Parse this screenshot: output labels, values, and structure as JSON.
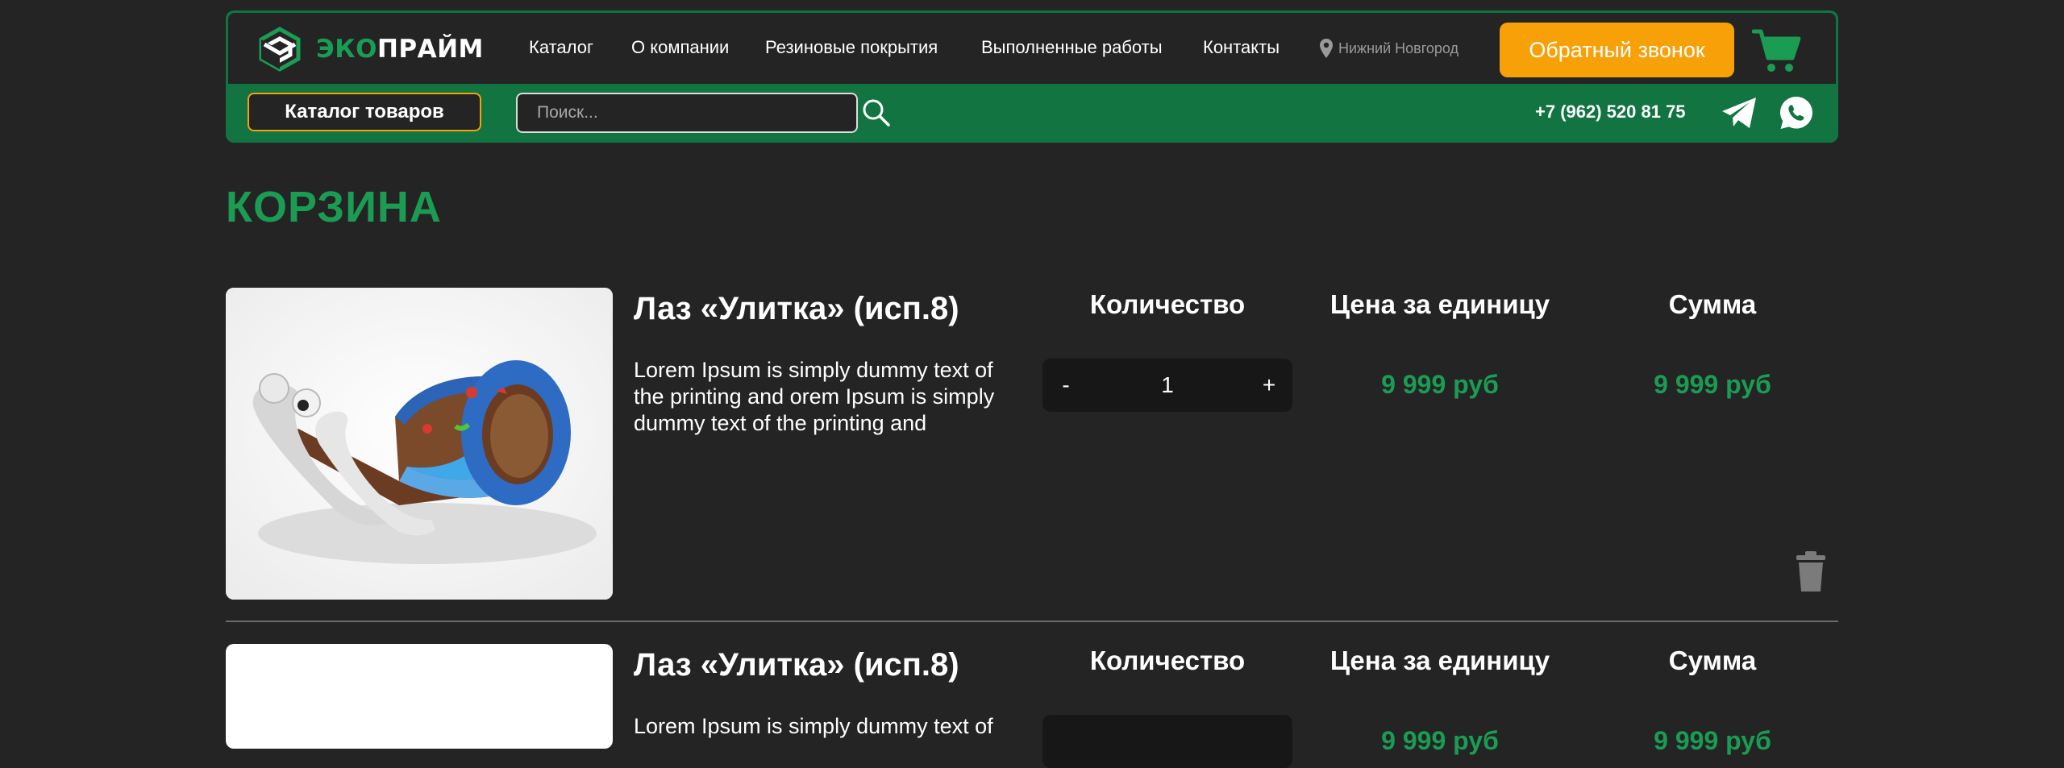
{
  "header": {
    "logo": {
      "eco": "ЭКО",
      "prime": "ПРАЙМ"
    },
    "nav": [
      "Каталог",
      "О компании",
      "Резиновые покрытия",
      "Выполненные работы",
      "Контакты"
    ],
    "city": "Нижний Новгород",
    "callback_label": "Обратный звонок",
    "catalog_button_label": "Каталог товаров",
    "search_placeholder": "Поиск...",
    "phone": "+7 (962) 520 81 75",
    "icons": [
      "location-pin-icon",
      "cart-icon",
      "search-icon",
      "telegram-icon",
      "whatsapp-icon"
    ]
  },
  "page": {
    "title": "КОРЗИНА"
  },
  "cart": {
    "columns": {
      "quantity": "Количество",
      "unit_price": "Цена за единицу",
      "sum": "Сумма"
    },
    "items": [
      {
        "name": "Лаз «Улитка» (исп.8)",
        "description": "Lorem Ipsum is simply dummy text of the printing and orem Ipsum is simply dummy text of the printing and",
        "qty_minus": "-",
        "quantity": "1",
        "qty_plus": "+",
        "unit_price": "9 999 руб",
        "sum": "9 999 руб"
      },
      {
        "name": "Лаз «Улитка» (исп.8)",
        "description": "Lorem Ipsum is simply dummy text of",
        "unit_price": "9 999 руб",
        "sum": "9 999 руб"
      }
    ]
  },
  "colors": {
    "brand_green": "#117441",
    "accent_green": "#1a9c53",
    "accent_orange": "#f7a008",
    "background": "#242424"
  }
}
